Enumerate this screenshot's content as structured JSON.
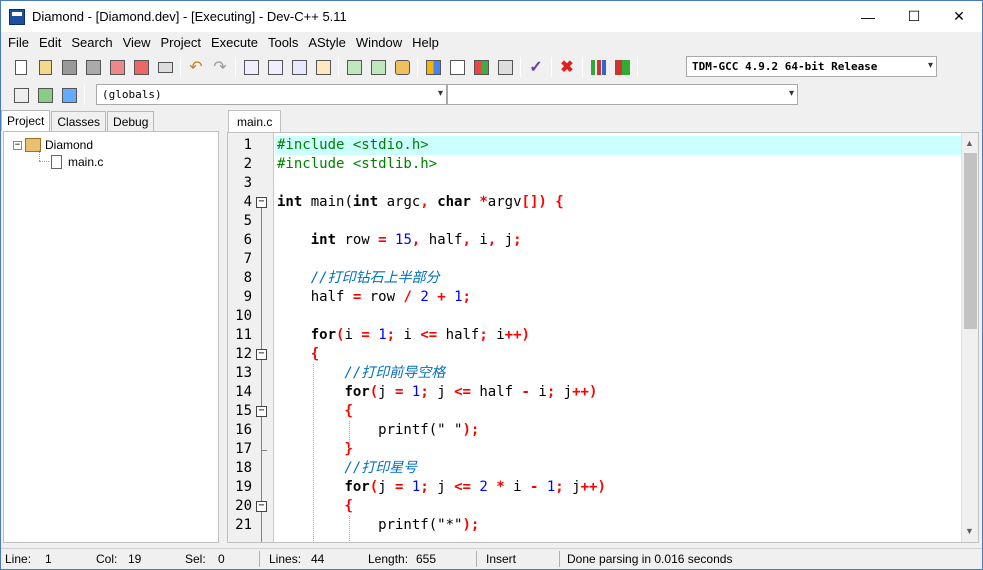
{
  "window": {
    "title": "Diamond - [Diamond.dev] - [Executing] - Dev-C++ 5.11",
    "minimize": "—",
    "maximize": "☐",
    "close": "✕"
  },
  "menu": [
    "File",
    "Edit",
    "Search",
    "View",
    "Project",
    "Execute",
    "Tools",
    "AStyle",
    "Window",
    "Help"
  ],
  "toolbar": {
    "compiler_select": "TDM-GCC 4.9.2 64-bit Release",
    "scope_select": "(globals)",
    "member_select": ""
  },
  "left_panel": {
    "tabs": [
      "Project",
      "Classes",
      "Debug"
    ],
    "active_tab": "Project",
    "tree": {
      "expander": "−",
      "project": "Diamond",
      "file": "main.c"
    }
  },
  "editor": {
    "tab": "main.c",
    "lines": [
      {
        "n": "1",
        "tokens": [
          {
            "t": "#include <stdio.h>",
            "c": "pp"
          }
        ]
      },
      {
        "n": "2",
        "tokens": [
          {
            "t": "#include <stdlib.h>",
            "c": "pp"
          }
        ]
      },
      {
        "n": "3",
        "tokens": []
      },
      {
        "n": "4",
        "tokens": [
          {
            "t": "int",
            "c": "kw"
          },
          {
            "t": " main(",
            "c": ""
          },
          {
            "t": "int",
            "c": "kw"
          },
          {
            "t": " argc",
            "c": ""
          },
          {
            "t": ",",
            "c": "op"
          },
          {
            "t": " ",
            "c": ""
          },
          {
            "t": "char",
            "c": "kw"
          },
          {
            "t": " ",
            "c": ""
          },
          {
            "t": "*",
            "c": "op"
          },
          {
            "t": "argv",
            "c": ""
          },
          {
            "t": "[])",
            "c": "op"
          },
          {
            "t": " ",
            "c": ""
          },
          {
            "t": "{",
            "c": "op"
          }
        ]
      },
      {
        "n": "5",
        "tokens": []
      },
      {
        "n": "6",
        "tokens": [
          {
            "t": "    ",
            "c": ""
          },
          {
            "t": "int",
            "c": "kw"
          },
          {
            "t": " row ",
            "c": ""
          },
          {
            "t": "=",
            "c": "op"
          },
          {
            "t": " ",
            "c": ""
          },
          {
            "t": "15",
            "c": "num"
          },
          {
            "t": ",",
            "c": "op"
          },
          {
            "t": " half",
            "c": ""
          },
          {
            "t": ",",
            "c": "op"
          },
          {
            "t": " i",
            "c": ""
          },
          {
            "t": ",",
            "c": "op"
          },
          {
            "t": " j",
            "c": ""
          },
          {
            "t": ";",
            "c": "op"
          }
        ]
      },
      {
        "n": "7",
        "tokens": []
      },
      {
        "n": "8",
        "tokens": [
          {
            "t": "    //打印钻石上半部分",
            "c": "cm"
          }
        ]
      },
      {
        "n": "9",
        "tokens": [
          {
            "t": "    half ",
            "c": ""
          },
          {
            "t": "=",
            "c": "op"
          },
          {
            "t": " row ",
            "c": ""
          },
          {
            "t": "/",
            "c": "op"
          },
          {
            "t": " ",
            "c": ""
          },
          {
            "t": "2",
            "c": "num"
          },
          {
            "t": " ",
            "c": ""
          },
          {
            "t": "+",
            "c": "op"
          },
          {
            "t": " ",
            "c": ""
          },
          {
            "t": "1",
            "c": "num"
          },
          {
            "t": ";",
            "c": "op"
          }
        ]
      },
      {
        "n": "10",
        "tokens": []
      },
      {
        "n": "11",
        "tokens": [
          {
            "t": "    ",
            "c": ""
          },
          {
            "t": "for",
            "c": "kw"
          },
          {
            "t": "(",
            "c": "op"
          },
          {
            "t": "i ",
            "c": ""
          },
          {
            "t": "=",
            "c": "op"
          },
          {
            "t": " ",
            "c": ""
          },
          {
            "t": "1",
            "c": "num"
          },
          {
            "t": ";",
            "c": "op"
          },
          {
            "t": " i ",
            "c": ""
          },
          {
            "t": "<=",
            "c": "op"
          },
          {
            "t": " half",
            "c": ""
          },
          {
            "t": ";",
            "c": "op"
          },
          {
            "t": " i",
            "c": ""
          },
          {
            "t": "++)",
            "c": "op"
          }
        ]
      },
      {
        "n": "12",
        "tokens": [
          {
            "t": "    ",
            "c": ""
          },
          {
            "t": "{",
            "c": "op"
          }
        ]
      },
      {
        "n": "13",
        "tokens": [
          {
            "t": "        //打印前导空格",
            "c": "cm"
          }
        ]
      },
      {
        "n": "14",
        "tokens": [
          {
            "t": "        ",
            "c": ""
          },
          {
            "t": "for",
            "c": "kw"
          },
          {
            "t": "(",
            "c": "op"
          },
          {
            "t": "j ",
            "c": ""
          },
          {
            "t": "=",
            "c": "op"
          },
          {
            "t": " ",
            "c": ""
          },
          {
            "t": "1",
            "c": "num"
          },
          {
            "t": ";",
            "c": "op"
          },
          {
            "t": " j ",
            "c": ""
          },
          {
            "t": "<=",
            "c": "op"
          },
          {
            "t": " half ",
            "c": ""
          },
          {
            "t": "-",
            "c": "op"
          },
          {
            "t": " i",
            "c": ""
          },
          {
            "t": ";",
            "c": "op"
          },
          {
            "t": " j",
            "c": ""
          },
          {
            "t": "++)",
            "c": "op"
          }
        ]
      },
      {
        "n": "15",
        "tokens": [
          {
            "t": "        ",
            "c": ""
          },
          {
            "t": "{",
            "c": "op"
          }
        ]
      },
      {
        "n": "16",
        "tokens": [
          {
            "t": "            printf(",
            "c": ""
          },
          {
            "t": "\" \"",
            "c": "str"
          },
          {
            "t": ");",
            "c": "op"
          }
        ]
      },
      {
        "n": "17",
        "tokens": [
          {
            "t": "        ",
            "c": ""
          },
          {
            "t": "}",
            "c": "op"
          }
        ]
      },
      {
        "n": "18",
        "tokens": [
          {
            "t": "        //打印星号",
            "c": "cm"
          }
        ]
      },
      {
        "n": "19",
        "tokens": [
          {
            "t": "        ",
            "c": ""
          },
          {
            "t": "for",
            "c": "kw"
          },
          {
            "t": "(",
            "c": "op"
          },
          {
            "t": "j ",
            "c": ""
          },
          {
            "t": "=",
            "c": "op"
          },
          {
            "t": " ",
            "c": ""
          },
          {
            "t": "1",
            "c": "num"
          },
          {
            "t": ";",
            "c": "op"
          },
          {
            "t": " j ",
            "c": ""
          },
          {
            "t": "<=",
            "c": "op"
          },
          {
            "t": " ",
            "c": ""
          },
          {
            "t": "2",
            "c": "num"
          },
          {
            "t": " ",
            "c": ""
          },
          {
            "t": "*",
            "c": "op"
          },
          {
            "t": " i ",
            "c": ""
          },
          {
            "t": "-",
            "c": "op"
          },
          {
            "t": " ",
            "c": ""
          },
          {
            "t": "1",
            "c": "num"
          },
          {
            "t": ";",
            "c": "op"
          },
          {
            "t": " j",
            "c": ""
          },
          {
            "t": "++)",
            "c": "op"
          }
        ]
      },
      {
        "n": "20",
        "tokens": [
          {
            "t": "        ",
            "c": ""
          },
          {
            "t": "{",
            "c": "op"
          }
        ]
      },
      {
        "n": "21",
        "tokens": [
          {
            "t": "            printf(",
            "c": ""
          },
          {
            "t": "\"*\"",
            "c": "str"
          },
          {
            "t": ");",
            "c": "op"
          }
        ]
      }
    ]
  },
  "status": {
    "line_label": "Line:",
    "line_value": "1",
    "col_label": "Col:",
    "col_value": "19",
    "sel_label": "Sel:",
    "sel_value": "0",
    "lines_label": "Lines:",
    "lines_value": "44",
    "length_label": "Length:",
    "length_value": "655",
    "mode": "Insert",
    "message": "Done parsing in 0.016 seconds"
  }
}
